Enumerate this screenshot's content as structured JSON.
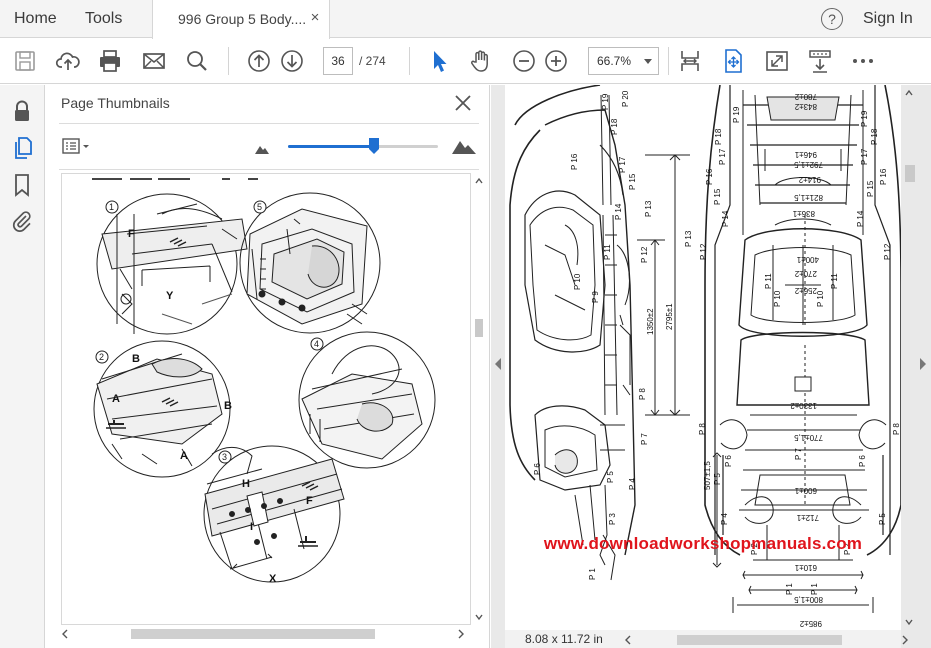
{
  "menubar": {
    "home_label": "Home",
    "tools_label": "Tools",
    "document_tab": "996 Group 5 Body....",
    "tab_close": "×",
    "help_glyph": "?",
    "sign_in_label": "Sign In"
  },
  "toolbar": {
    "current_page": "36",
    "page_total": "/  274",
    "zoom": "66.7%",
    "icons": [
      "save-icon",
      "cloud-upload-icon",
      "print-icon",
      "email-icon",
      "find-icon",
      "previous-page-icon",
      "next-page-icon",
      "select-pointer-icon",
      "hand-tool-icon",
      "zoom-out-icon",
      "zoom-in-icon",
      "fit-width-icon",
      "fit-page-icon",
      "full-screen-icon",
      "scroll-mode-icon",
      "more-tools-icon"
    ]
  },
  "rail": {
    "icons": [
      "lock-icon",
      "pages-icon",
      "bookmark-icon",
      "attachment-icon"
    ]
  },
  "thumbnails_panel": {
    "title": "Page Thumbnails",
    "slider_level": 0.57,
    "figure_labels": {
      "fig1": "1",
      "fig2": "2",
      "fig3": "3",
      "fig4": "4",
      "fig5": "5",
      "label_F": "F",
      "label_Y": "Y",
      "label_B": "B",
      "label_A": "A",
      "label_H": "H",
      "label_I": "I",
      "label_X": "X"
    }
  },
  "document": {
    "page_size": "8.08 x 11.72 in",
    "watermark": "www.downloadworkshopmanuals.com",
    "labels": {
      "p1": "P 1",
      "p2": "P 2",
      "p3": "P 3",
      "p4": "P 4",
      "p5": "P 5",
      "p6": "P 6",
      "p7": "P 7",
      "p8": "P 8",
      "p9": "P 9",
      "p10": "P 10",
      "p11": "P 11",
      "p12": "P 12",
      "p13": "P 13",
      "p14": "P 14",
      "p15": "P 15",
      "p16": "P 16",
      "p17": "P 17",
      "p18": "P 18",
      "p19": "P 19",
      "p20": "P 20",
      "d_2795": "2795±1",
      "d_1350": "1350±2",
      "d_507": "507±1,5",
      "d_985": "985±2",
      "d_800": "800±1,5",
      "d_770": "770±1,5",
      "d_1330": "1330±2",
      "d_600": "600±1",
      "d_712": "712±1",
      "d_610": "610±1",
      "d_400": "400±1",
      "d_270": "270±2",
      "d_256": "256±2",
      "d_836": "836±1",
      "d_821": "821±1,5",
      "d_914": "914±2",
      "d_792": "792±1,5",
      "d_946": "946±1",
      "d_843": "843±2",
      "d_780": "780±2"
    }
  }
}
